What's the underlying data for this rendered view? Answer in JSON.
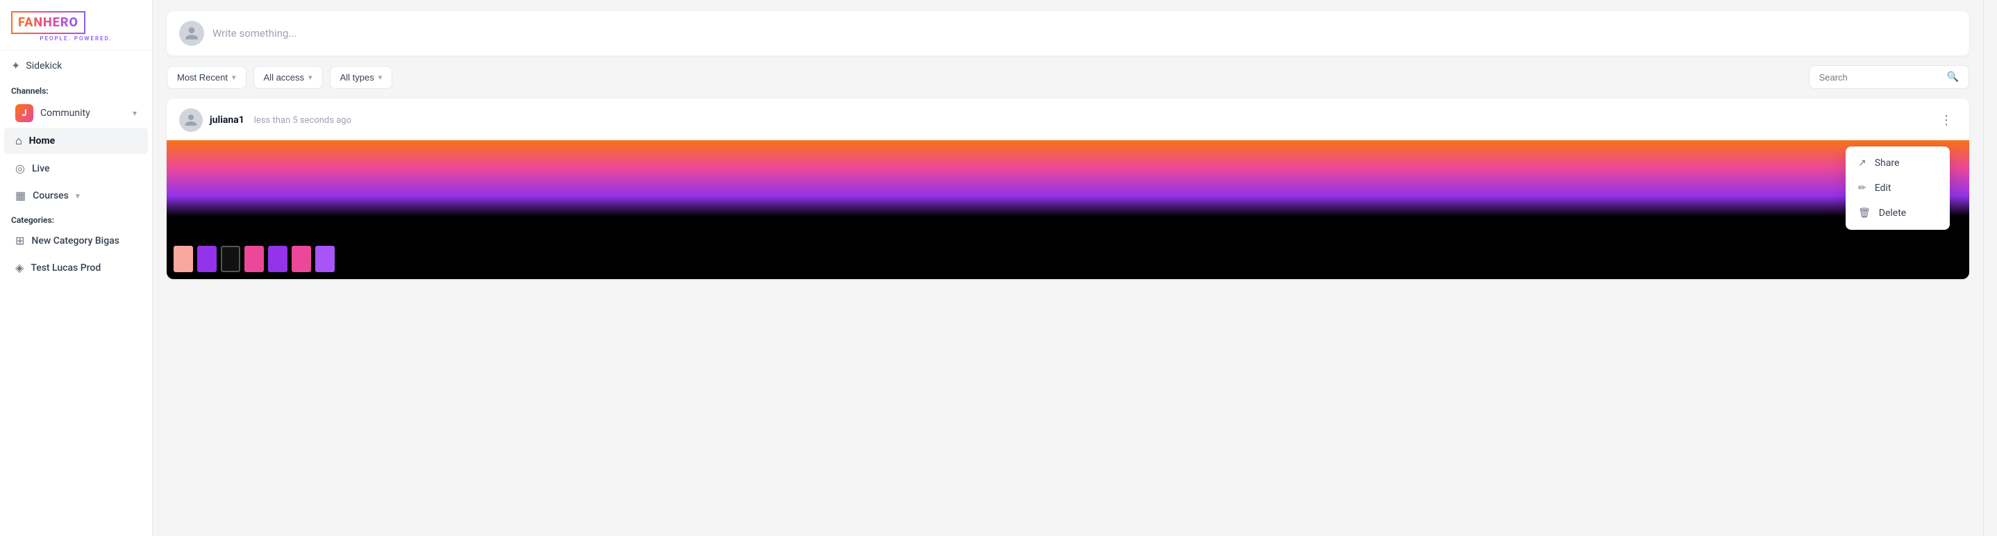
{
  "logo": {
    "text": "FANHERO",
    "subtitle": "PEOPLE. POWERED."
  },
  "sidebar": {
    "sidekick_label": "Sidekick",
    "channels_label": "Channels:",
    "community_channel": "Community",
    "nav_items": [
      {
        "label": "Home",
        "icon": "🏠",
        "active": true
      },
      {
        "label": "Live",
        "icon": "📡"
      },
      {
        "label": "Courses",
        "icon": "📚",
        "has_chevron": true
      }
    ],
    "categories_label": "Categories:",
    "categories": [
      {
        "label": "New Category Bigas"
      },
      {
        "label": "Test Lucas Prod"
      }
    ]
  },
  "composer": {
    "placeholder": "Write something..."
  },
  "filters": {
    "most_recent": "Most Recent",
    "all_access": "All access",
    "all_types": "All types",
    "search_placeholder": "Search"
  },
  "post": {
    "author": "juliana1",
    "time": "less than 5 seconds ago",
    "menu_dots": "⋮"
  },
  "dropdown": {
    "share_label": "Share",
    "edit_label": "Edit",
    "delete_label": "Delete"
  }
}
